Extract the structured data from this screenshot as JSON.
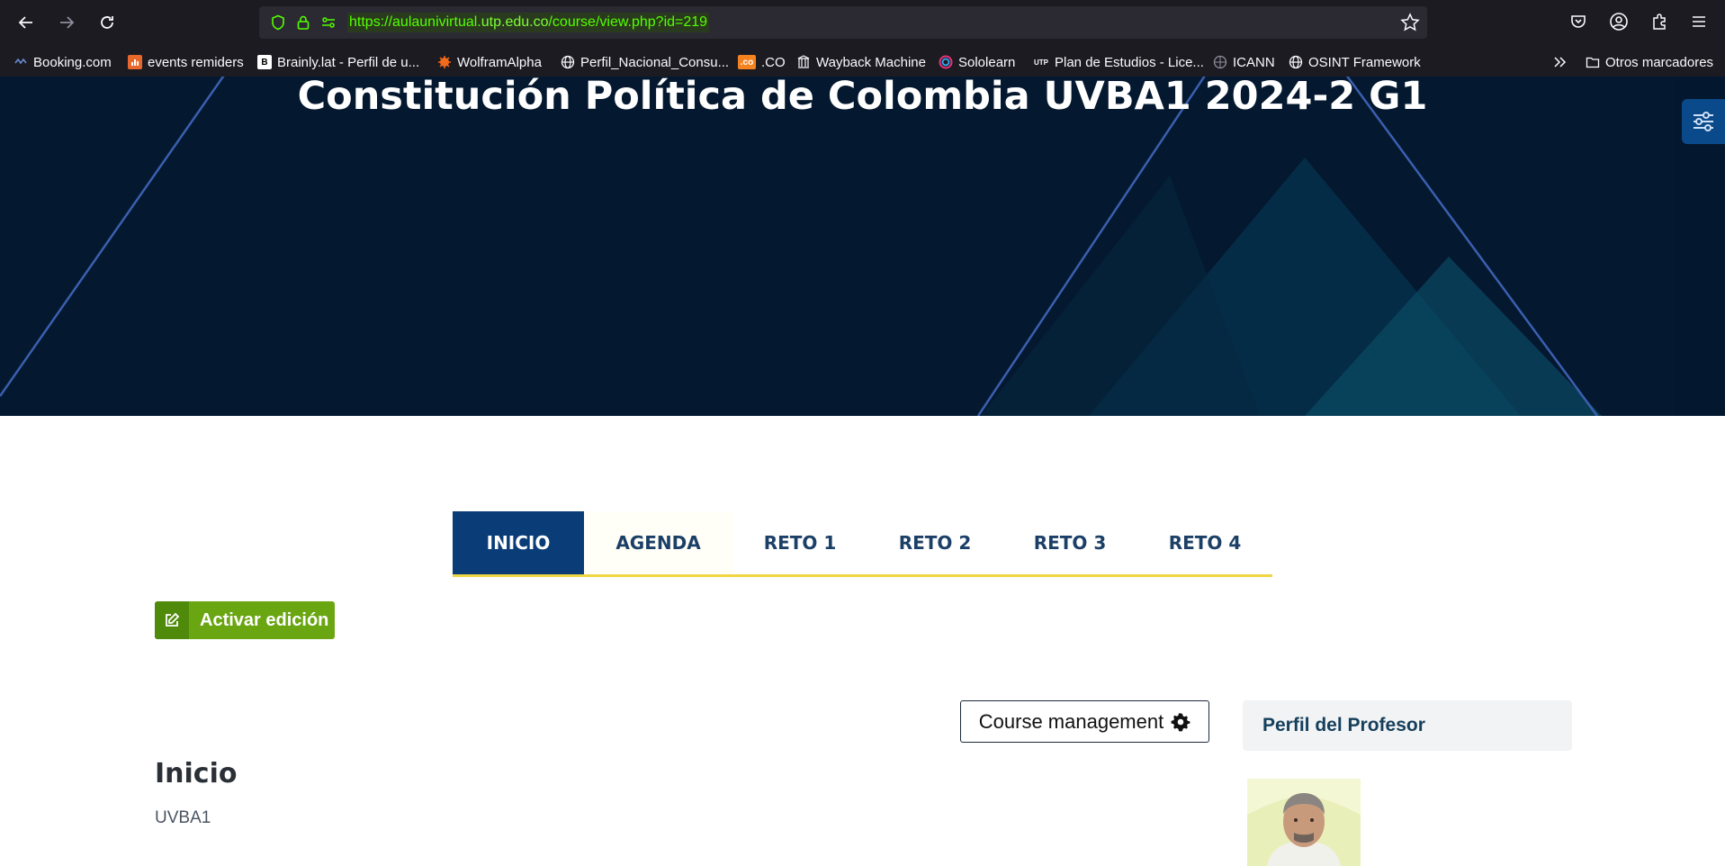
{
  "browser": {
    "url_prefix": "https://aulaunivirtual.",
    "url_host": "utp.edu.co",
    "url_path": "/course/view.php?id=219",
    "bookmarks": [
      {
        "label": "Booking.com",
        "icon": "booking-icon"
      },
      {
        "label": "events remiders",
        "icon": "events-icon"
      },
      {
        "label": "Brainly.lat - Perfil de u...",
        "icon": "brainly-icon"
      },
      {
        "label": "WolframAlpha",
        "icon": "wolfram-icon"
      },
      {
        "label": "Perfil_Nacional_Consu...",
        "icon": "globe-icon"
      },
      {
        "label": ".CO",
        "icon": "co-icon"
      },
      {
        "label": "Wayback Machine",
        "icon": "wayback-icon"
      },
      {
        "label": "Sololearn",
        "icon": "sololearn-icon"
      },
      {
        "label": "Plan de Estudios - Lice...",
        "icon": "utp-icon"
      },
      {
        "label": "ICANN",
        "icon": "icann-icon"
      },
      {
        "label": "OSINT Framework",
        "icon": "globe-icon"
      }
    ],
    "other_bookmarks": "Otros marcadores",
    "co_badge": ".co",
    "brainly_badge": "B",
    "utp_badge": "UTP"
  },
  "hero": {
    "title": "Constitución Política de Colombia UVBA1 2024-2 G1"
  },
  "tabs": [
    {
      "label": "INICIO",
      "active": true
    },
    {
      "label": "AGENDA",
      "active": false
    },
    {
      "label": "RETO 1",
      "active": false
    },
    {
      "label": "RETO 2",
      "active": false
    },
    {
      "label": "RETO 3",
      "active": false
    },
    {
      "label": "RETO 4",
      "active": false
    }
  ],
  "actions": {
    "edit_label": "Activar edición",
    "course_management_label": "Course management"
  },
  "section": {
    "title": "Inicio",
    "subtitle": "UVBA1"
  },
  "sidebar": {
    "profile_title": "Perfil del Profesor"
  },
  "colors": {
    "accent_blue": "#0a3d78",
    "tab_underline": "#f0d645",
    "edit_green": "#6aa512",
    "hero_bg": "#04182f"
  }
}
